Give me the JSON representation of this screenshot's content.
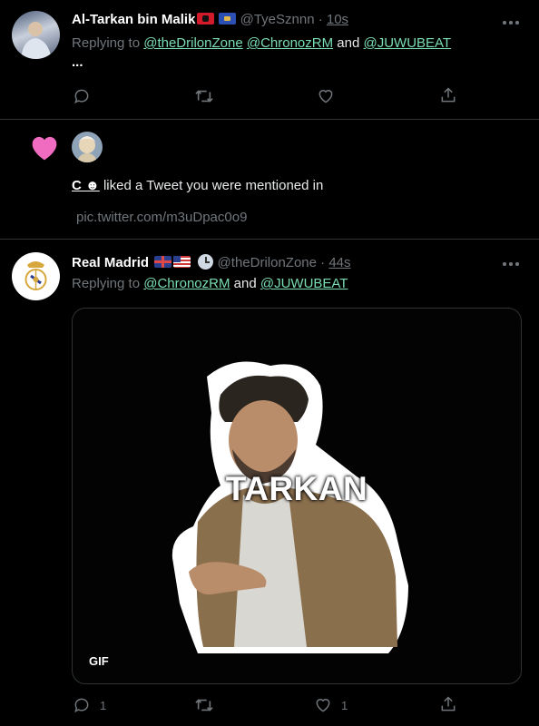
{
  "tweet1": {
    "author_name": "Al-Tarkan bin Malik",
    "handle": "@TyeSznnn",
    "separator": "·",
    "time": "10s",
    "replying_prefix": "Replying to",
    "mentions": [
      "@theDrilonZone",
      "@ChronozRM",
      "@JUWUBEAT"
    ],
    "and_word": "and",
    "text": "..."
  },
  "notification": {
    "user": "C ☻",
    "text": "liked a Tweet you were mentioned in",
    "link": "pic.twitter.com/m3uDpac0o9"
  },
  "tweet2": {
    "author_name": "Real Madrid",
    "handle": "@theDrilonZone",
    "separator": "·",
    "time": "44s",
    "replying_prefix": "Replying to",
    "mentions": [
      "@ChronozRM",
      "@JUWUBEAT"
    ],
    "and_word": "and",
    "media": {
      "caption": "TARKAN",
      "badge": "GIF"
    },
    "reply_count": "1",
    "like_count": "1"
  },
  "colors": {
    "accent_link": "#79dcb3",
    "heart": "#f06cc0",
    "background": "#000000",
    "muted": "#71767b"
  }
}
